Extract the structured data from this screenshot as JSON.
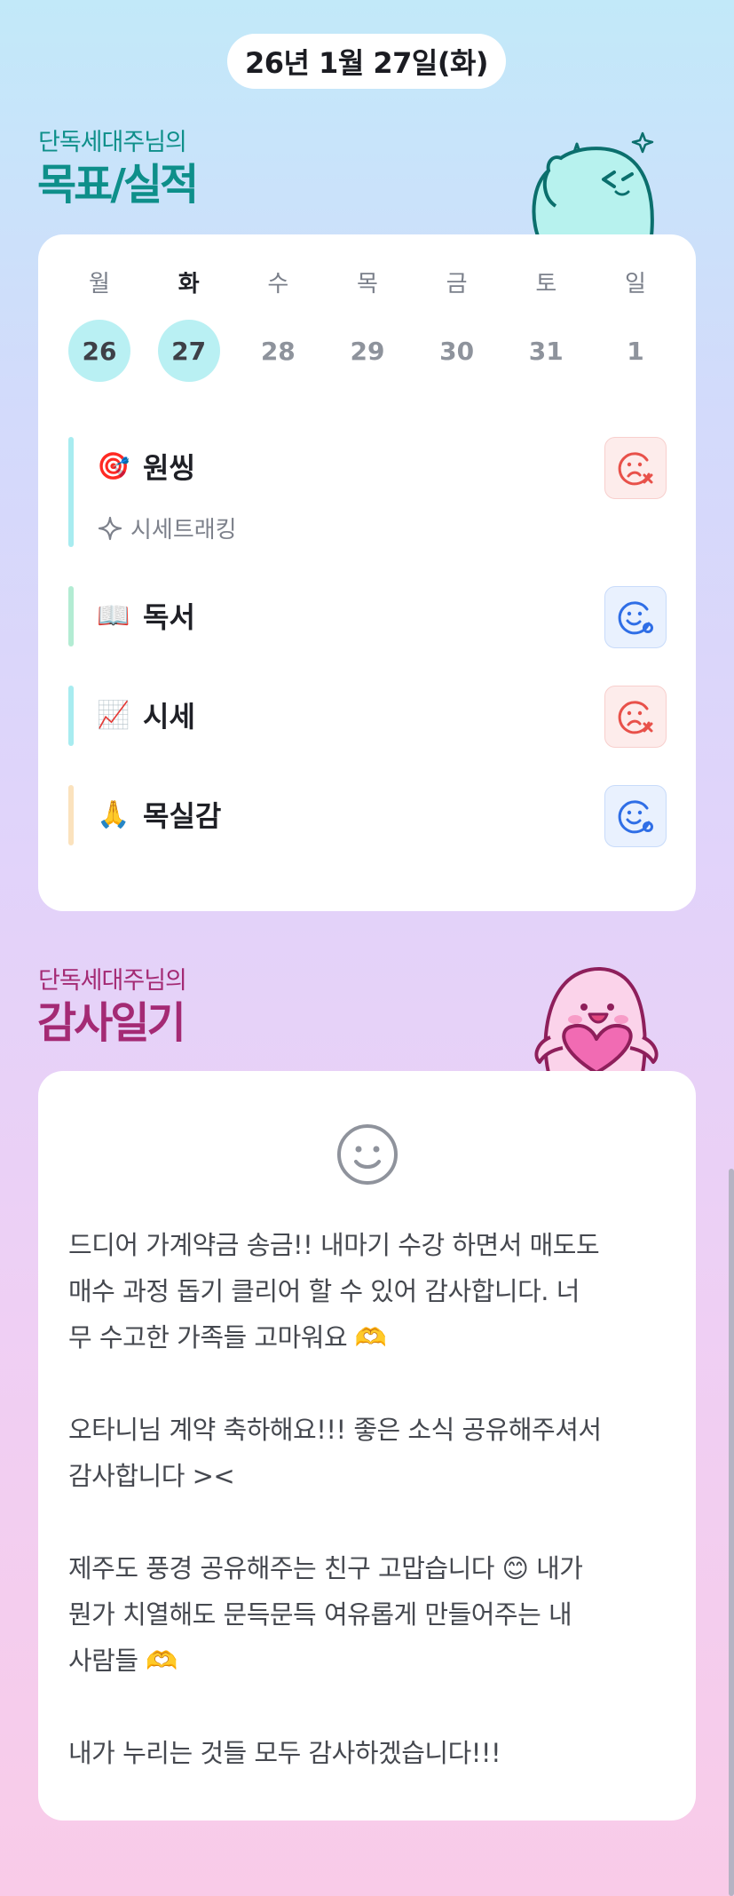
{
  "date": "26년 1월 27일(화)",
  "goals_section": {
    "subtitle": "단독세대주님의",
    "title": "목표/실적"
  },
  "week": [
    {
      "weekday": "월",
      "day": "26",
      "done": true,
      "active": false
    },
    {
      "weekday": "화",
      "day": "27",
      "done": true,
      "active": true
    },
    {
      "weekday": "수",
      "day": "28",
      "done": false,
      "active": false
    },
    {
      "weekday": "목",
      "day": "29",
      "done": false,
      "active": false
    },
    {
      "weekday": "금",
      "day": "30",
      "done": false,
      "active": false
    },
    {
      "weekday": "토",
      "day": "31",
      "done": false,
      "active": false
    },
    {
      "weekday": "일",
      "day": "1",
      "done": false,
      "active": false
    }
  ],
  "goals": [
    {
      "emoji": "🎯",
      "name": "원씽",
      "sub": "시세트래킹",
      "status": "fail",
      "bar_color": "#a8ecf0"
    },
    {
      "emoji": "📖",
      "name": "독서",
      "status": "ok",
      "bar_color": "#b3ecd3"
    },
    {
      "emoji": "📈",
      "name": "시세",
      "status": "fail",
      "bar_color": "#a8ecf0"
    },
    {
      "emoji": "🙏",
      "name": "목실감",
      "status": "ok",
      "bar_color": "#fbe2bd"
    }
  ],
  "diary_section": {
    "subtitle": "단독세대주님의",
    "title": "감사일기"
  },
  "diary": {
    "icon": "smiley-icon",
    "paragraphs": [
      "드디어 가계약금 송금!! 내마기 수강 하면서 매도도\n매수 과정 돕기 클리어 할 수 있어 감사합니다. 너\n무 수고한 가족들 고마워요 🫶",
      "오타니님 계약 축하해요!!! 좋은 소식 공유해주셔서\n감사합니다 ><",
      "제주도 풍경 공유해주는 친구 고맙습니다 😊 내가\n뭔가 치열해도 문득문득 여유롭게 만들어주는 내\n사람들 🫶",
      "내가 누리는 것들 모두 감사하겠습니다!!!"
    ]
  },
  "colors": {
    "teal": "#0e8f8a",
    "plum": "#a42a74",
    "done_circle": "#b9f0f3",
    "fail_icon": "#e8514a",
    "ok_icon": "#2f6ee6"
  }
}
